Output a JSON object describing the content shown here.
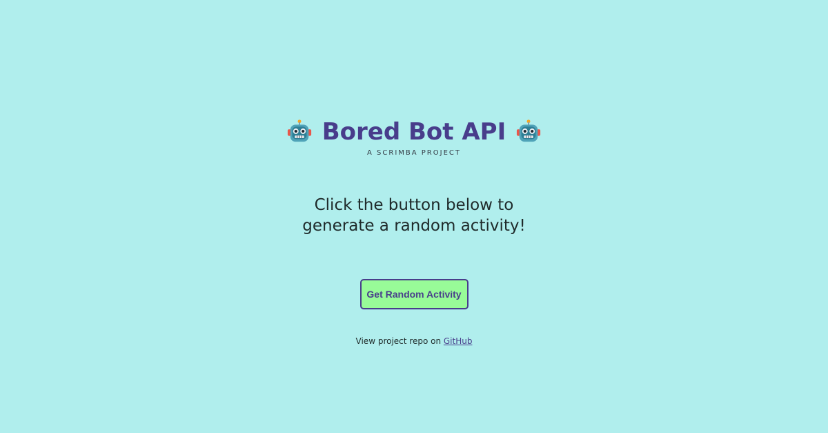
{
  "header": {
    "title": "Bored Bot API",
    "subtitle": "A SCRIMBA PROJECT",
    "left_icon": "robot-face-icon",
    "right_icon": "robot-face-icon"
  },
  "prompt": {
    "line1": "Click the button below to",
    "line2": "generate a random activity!"
  },
  "button": {
    "label": "Get Random Activity"
  },
  "footer": {
    "text": "View project repo on ",
    "link_label": "GitHub"
  },
  "colors": {
    "background": "#b0eeed",
    "title": "#483d8b",
    "button_bg": "#98fb98",
    "button_border": "#483d8b"
  }
}
